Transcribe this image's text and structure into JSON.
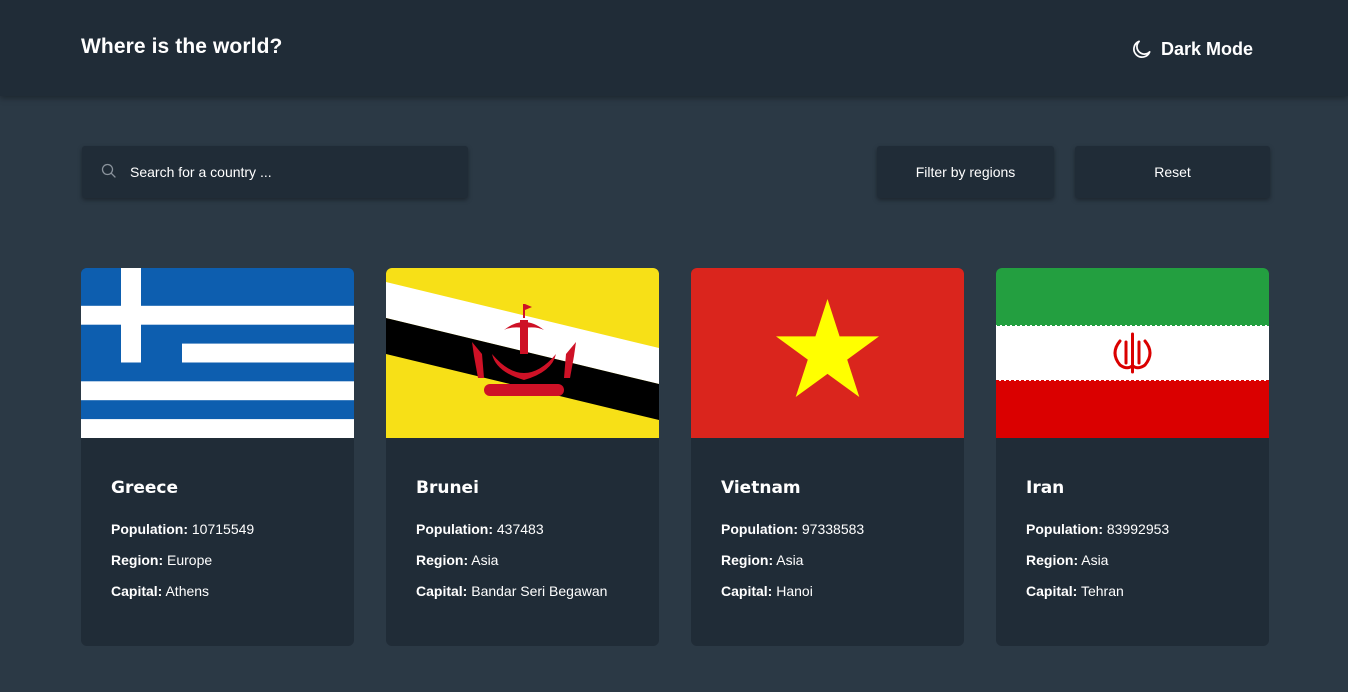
{
  "header": {
    "title": "Where is the world?",
    "mode_label": "Dark Mode",
    "mode_icon": "moon-icon"
  },
  "search": {
    "placeholder": "Search for a country ...",
    "value": "",
    "icon": "search-icon"
  },
  "filter": {
    "label": "Filter by regions"
  },
  "reset": {
    "label": "Reset"
  },
  "labels": {
    "population": "Population:",
    "region": "Region:",
    "capital": "Capital:"
  },
  "countries": [
    {
      "name": "Greece",
      "population": "10715549",
      "region": "Europe",
      "capital": "Athens",
      "flag": "greece-flag"
    },
    {
      "name": "Brunei",
      "population": "437483",
      "region": "Asia",
      "capital": "Bandar Seri Begawan",
      "flag": "brunei-flag"
    },
    {
      "name": "Vietnam",
      "population": "97338583",
      "region": "Asia",
      "capital": "Hanoi",
      "flag": "vietnam-flag"
    },
    {
      "name": "Iran",
      "population": "83992953",
      "region": "Asia",
      "capital": "Tehran",
      "flag": "iran-flag"
    }
  ],
  "colors": {
    "background": "#2b3945",
    "elements": "#202c37",
    "text": "#ffffff"
  }
}
